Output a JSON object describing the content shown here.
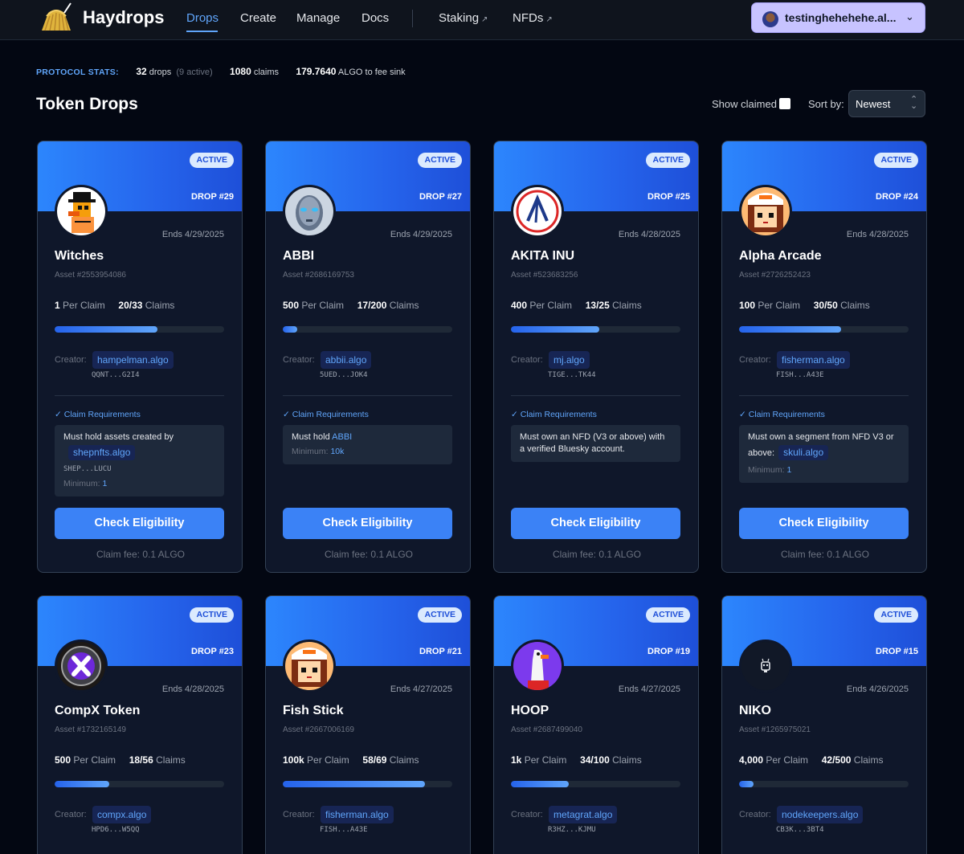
{
  "nav": {
    "brand": "Haydrops",
    "links": [
      "Drops",
      "Create",
      "Manage",
      "Docs"
    ],
    "external_links": [
      "Staking",
      "NFDs"
    ],
    "account": "testinghehehehe.al..."
  },
  "stats": {
    "label": "PROTOCOL STATS:",
    "drops": "32",
    "drops_unit": "drops",
    "drops_active": "(9 active)",
    "claims": "1080",
    "claims_unit": "claims",
    "fee_sink": "179.7640",
    "fee_sink_unit": "ALGO to fee sink"
  },
  "page": {
    "title": "Token Drops",
    "show_claimed": "Show claimed",
    "sort_label": "Sort by:",
    "sort_value": "Newest"
  },
  "card_common": {
    "active": "ACTIVE",
    "per_claim": "Per Claim",
    "claims": "Claims",
    "creator": "Creator:",
    "requirements": "Claim Requirements",
    "minimum": "Minimum:",
    "check": "Check Eligibility",
    "fee": "Claim fee: 0.1 ALGO"
  },
  "cards": [
    {
      "drop": "DROP #29",
      "ends": "Ends 4/29/2025",
      "name": "Witches",
      "asset": "Asset #2553954086",
      "amount": "1",
      "claims": "20/33",
      "progress": 0.606,
      "creator": "hampelman.algo",
      "creator_addr": "QQNT...G2I4",
      "req_text": "Must hold assets created by",
      "req_pill": "shepnfts.algo",
      "req_addr": "SHEP...LUCU",
      "req_min": "1"
    },
    {
      "drop": "DROP #27",
      "ends": "Ends 4/29/2025",
      "name": "ABBI",
      "asset": "Asset #2686169753",
      "amount": "500",
      "claims": "17/200",
      "progress": 0.085,
      "creator": "abbii.algo",
      "creator_addr": "5UED...JOK4",
      "req_text": "Must hold",
      "req_link": "ABBI",
      "req_min": "10k"
    },
    {
      "drop": "DROP #25",
      "ends": "Ends 4/28/2025",
      "name": "AKITA INU",
      "asset": "Asset #523683256",
      "amount": "400",
      "claims": "13/25",
      "progress": 0.52,
      "creator": "mj.algo",
      "creator_addr": "TIGE...TK44",
      "req_text": "Must own an NFD (V3 or above) with a verified Bluesky account."
    },
    {
      "drop": "DROP #24",
      "ends": "Ends 4/28/2025",
      "name": "Alpha Arcade",
      "asset": "Asset #2726252423",
      "amount": "100",
      "claims": "30/50",
      "progress": 0.6,
      "creator": "fisherman.algo",
      "creator_addr": "FISH...A43E",
      "req_text": "Must own a segment from NFD V3 or above:",
      "req_pill": "skuli.algo",
      "req_min": "1"
    },
    {
      "drop": "DROP #23",
      "ends": "Ends 4/28/2025",
      "name": "CompX Token",
      "asset": "Asset #1732165149",
      "amount": "500",
      "claims": "18/56",
      "progress": 0.321,
      "creator": "compx.algo",
      "creator_addr": "HPD6...W5QQ"
    },
    {
      "drop": "DROP #21",
      "ends": "Ends 4/27/2025",
      "name": "Fish Stick",
      "asset": "Asset #2667006169",
      "amount": "100k",
      "claims": "58/69",
      "progress": 0.841,
      "creator": "fisherman.algo",
      "creator_addr": "FISH...A43E"
    },
    {
      "drop": "DROP #19",
      "ends": "Ends 4/27/2025",
      "name": "HOOP",
      "asset": "Asset #2687499040",
      "amount": "1k",
      "claims": "34/100",
      "progress": 0.34,
      "creator": "metagrat.algo",
      "creator_addr": "R3HZ...KJMU"
    },
    {
      "drop": "DROP #15",
      "ends": "Ends 4/26/2025",
      "name": "NIKO",
      "asset": "Asset #1265975021",
      "amount": "4,000",
      "claims": "42/500",
      "progress": 0.084,
      "creator": "nodekeepers.algo",
      "creator_addr": "CB3K...3BT4"
    }
  ],
  "colors": {
    "accent": "#3b82f6",
    "banner": "#2c86fd",
    "background": "#030712",
    "card": "#0f172a"
  }
}
